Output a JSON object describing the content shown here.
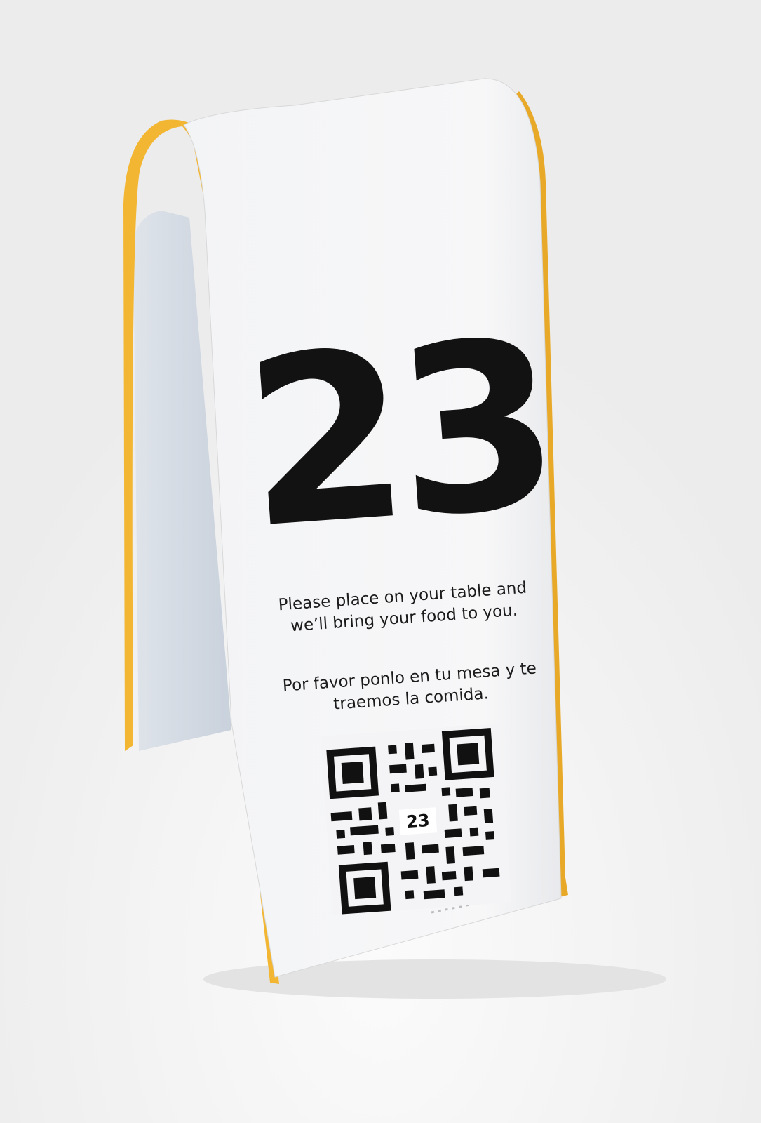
{
  "table_tent": {
    "number": "23",
    "message_en_line1": "Please place on your table and",
    "message_en_line2": "we’ll bring your food to you.",
    "message_es_line1": "Por favor ponlo en tu mesa y te",
    "message_es_line2": "traemos la comida.",
    "qr_center_label": "23",
    "qr_icon": "qr-code-icon"
  },
  "colors": {
    "background": "#f4f4f4",
    "trim_yellow": "#f2b632",
    "panel_white": "#f1f2f4",
    "ink": "#121212"
  }
}
